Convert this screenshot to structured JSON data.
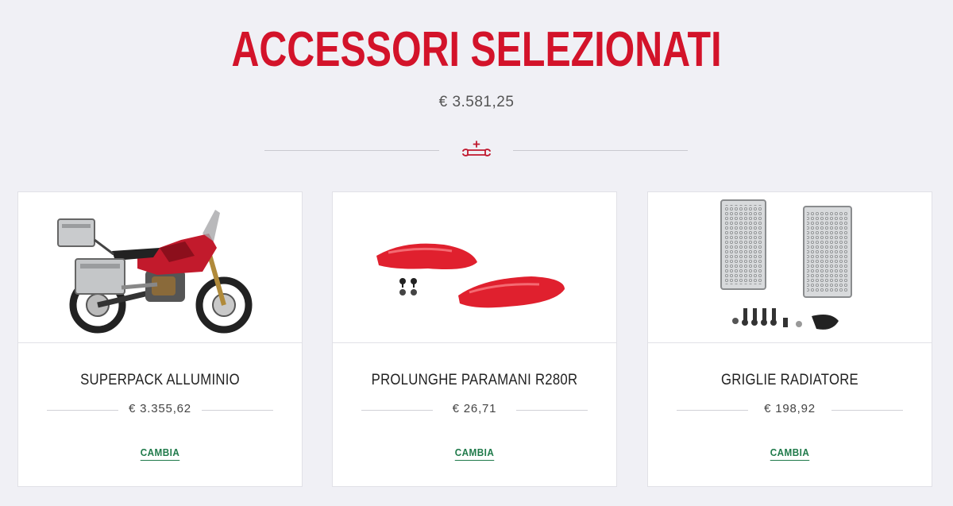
{
  "header": {
    "title": "ACCESSORI SELEZIONATI",
    "total_price": "€ 3.581,25",
    "divider_icon": "wrench-plus-icon"
  },
  "colors": {
    "accent": "#d3132a",
    "link": "#1f7a4a",
    "background": "#f0f0f5"
  },
  "cards": [
    {
      "name": "SUPERPACK ALLUMINIO",
      "price": "€ 3.355,62",
      "action": "CAMBIA",
      "image": "motorcycle-with-aluminium-cases"
    },
    {
      "name": "PROLUNGHE PARAMANI R280R",
      "price": "€ 26,71",
      "action": "CAMBIA",
      "image": "red-handguard-extensions"
    },
    {
      "name": "GRIGLIE RADIATORE",
      "price": "€ 198,92",
      "action": "CAMBIA",
      "image": "radiator-grilles"
    }
  ]
}
